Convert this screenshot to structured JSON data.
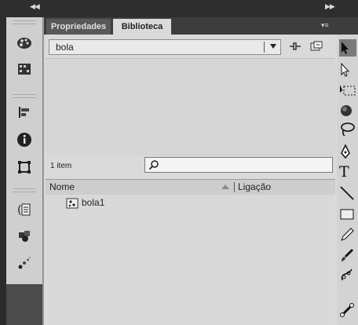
{
  "panel": {
    "tabs": [
      "Propriedades",
      "Biblioteca"
    ],
    "active_tab": "Biblioteca",
    "library_select": {
      "value": "bola",
      "options": [
        "bola"
      ]
    },
    "item_count": "1 item",
    "search": {
      "value": "",
      "placeholder": ""
    },
    "columns": {
      "name": "Nome",
      "linkage": "Ligação"
    },
    "items": [
      {
        "name": "bola1",
        "icon": "movieclip-symbol-icon"
      }
    ]
  },
  "left_tools": [
    "color-swatches-icon",
    "align-grid-icon",
    "align-icon",
    "info-icon",
    "transform-icon",
    "code-snippets-icon",
    "components-icon",
    "motion-presets-icon"
  ],
  "right_tools": [
    "selection-tool-icon",
    "subselection-tool-icon",
    "free-transform-tool-icon",
    "3d-rotation-tool-icon",
    "lasso-tool-icon",
    "pen-tool-icon",
    "text-tool-icon",
    "line-tool-icon",
    "rectangle-tool-icon",
    "pencil-tool-icon",
    "brush-tool-icon",
    "deco-tool-icon",
    "bone-tool-icon"
  ],
  "colors": {
    "panel_bg": "#dadada",
    "chrome_dark": "#3d3d3d",
    "toolbar_bg": "#cfcfcf"
  }
}
